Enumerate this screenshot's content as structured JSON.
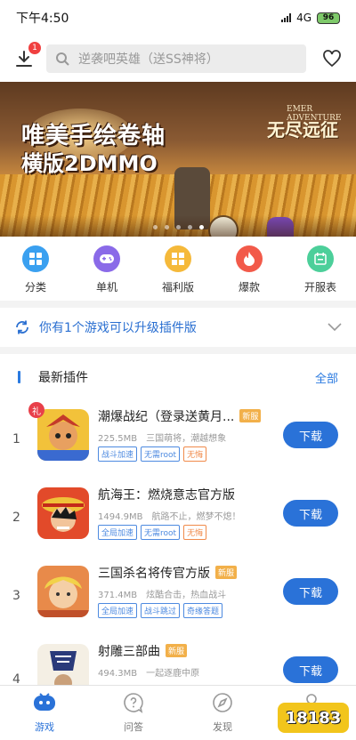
{
  "status_bar": {
    "time": "下午4:50",
    "network": "4G",
    "battery": "96"
  },
  "top_bar": {
    "download_badge": "1",
    "search_placeholder": "逆袭吧英雄（送SS神将）"
  },
  "banner": {
    "slogan_line1": "唯美手绘卷轴",
    "slogan_line2": "横版2DMMO",
    "logo_en": "EMER ADVENTURE",
    "logo_cn": "无尽远征",
    "dots": 5,
    "active_dot": 4
  },
  "quick_nav": [
    {
      "label": "分类",
      "icon": "grid-icon",
      "color": "#3aa0f0"
    },
    {
      "label": "单机",
      "icon": "gamepad-icon",
      "color": "#8a6ae8"
    },
    {
      "label": "福利版",
      "icon": "gift-grid-icon",
      "color": "#f5b93a"
    },
    {
      "label": "爆款",
      "icon": "flame-icon",
      "color": "#f25a4a"
    },
    {
      "label": "开服表",
      "icon": "calendar-icon",
      "color": "#4ccf9a"
    }
  ],
  "upgrade_bar": {
    "text": "你有1个游戏可以升级插件版"
  },
  "section": {
    "title": "最新插件",
    "more": "全部",
    "items": [
      {
        "rank": "1",
        "name": "潮爆战纪（登录送黄月...",
        "new_tag": "新服",
        "size": "225.5MB",
        "desc": "三国萌将，潮越想象",
        "tags": [
          "战斗加速",
          "无需root",
          "无悔"
        ],
        "tag_colors": [
          "blue",
          "blue",
          "orange"
        ],
        "button": "下载",
        "gift": "礼"
      },
      {
        "rank": "2",
        "name": "航海王：燃烧意志官方版",
        "new_tag": "",
        "size": "1494.9MB",
        "desc": "航路不止，燃梦不熄！",
        "tags": [
          "全局加速",
          "无需root",
          "无悔"
        ],
        "tag_colors": [
          "blue",
          "blue",
          "orange"
        ],
        "button": "下载"
      },
      {
        "rank": "3",
        "name": "三国杀名将传官方版",
        "new_tag": "新服",
        "size": "371.4MB",
        "desc": "炫酷合击，热血战斗",
        "tags": [
          "全局加速",
          "战斗跳过",
          "奇缘答题"
        ],
        "tag_colors": [
          "blue",
          "blue",
          "blue"
        ],
        "button": "下载"
      },
      {
        "rank": "4",
        "name": "射雕三部曲",
        "new_tag": "新服",
        "size": "494.3MB",
        "desc": "一起逐鹿中原",
        "tags": [],
        "tag_colors": [],
        "button": "下载"
      }
    ]
  },
  "bottom_nav": [
    {
      "label": "游戏",
      "icon": "game-controller-icon",
      "active": true
    },
    {
      "label": "问答",
      "icon": "question-bubble-icon",
      "active": false
    },
    {
      "label": "发现",
      "icon": "compass-icon",
      "active": false
    },
    {
      "label": "我",
      "icon": "user-icon",
      "active": false
    }
  ],
  "watermark": "18183",
  "colors": {
    "primary": "#2a72d8",
    "tag_new": "#f2b04a",
    "badge_red": "#e8404a"
  }
}
